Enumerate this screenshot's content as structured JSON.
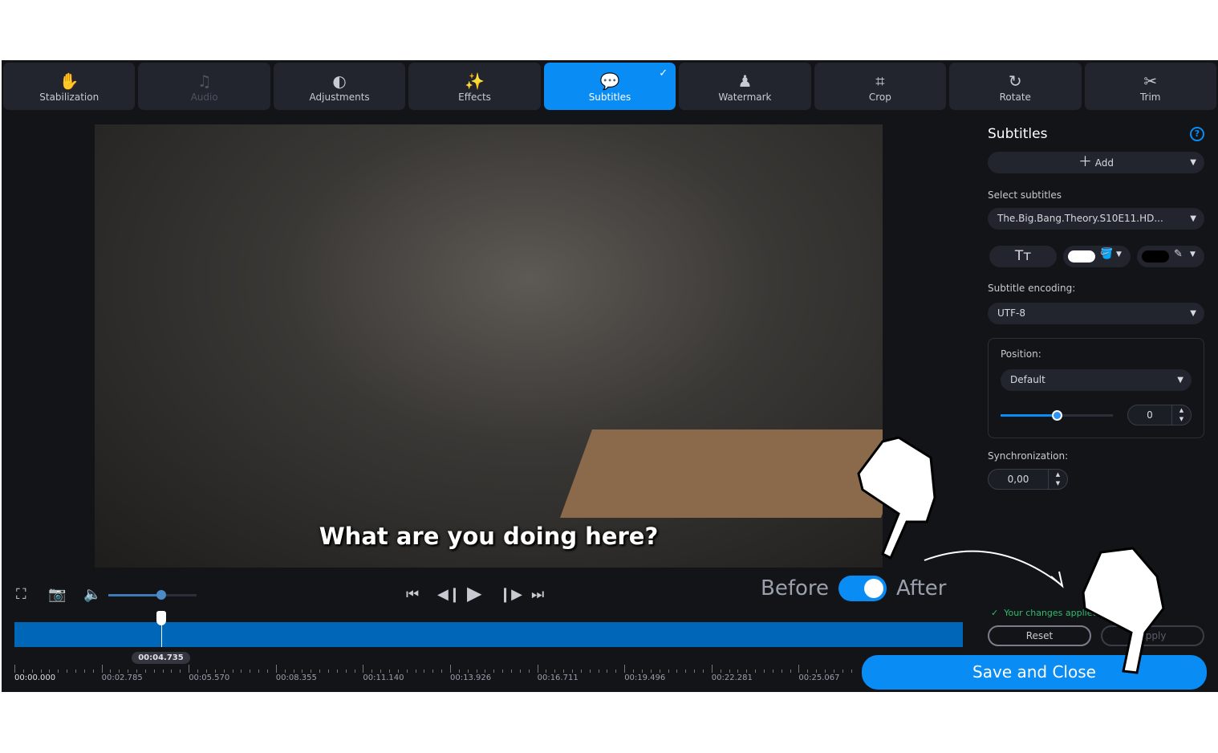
{
  "tabs": [
    {
      "key": "stabilization",
      "label": "Stabilization",
      "icon": "✋",
      "state": "normal"
    },
    {
      "key": "audio",
      "label": "Audio",
      "icon": "♫",
      "state": "disabled"
    },
    {
      "key": "adjustments",
      "label": "Adjustments",
      "icon": "◐",
      "state": "normal"
    },
    {
      "key": "effects",
      "label": "Effects",
      "icon": "✨",
      "state": "normal"
    },
    {
      "key": "subtitles",
      "label": "Subtitles",
      "icon": "💬",
      "state": "active"
    },
    {
      "key": "watermark",
      "label": "Watermark",
      "icon": "♟",
      "state": "normal"
    },
    {
      "key": "crop",
      "label": "Crop",
      "icon": "⌗",
      "state": "normal"
    },
    {
      "key": "rotate",
      "label": "Rotate",
      "icon": "↻",
      "state": "normal"
    },
    {
      "key": "trim",
      "label": "Trim",
      "icon": "✂",
      "state": "normal"
    }
  ],
  "active_check": "✓",
  "video": {
    "subtitle_text": "What are you doing here?",
    "volume": 0.6
  },
  "compare": {
    "before": "Before",
    "after": "After",
    "enabled": true
  },
  "timeline": {
    "current_time": "00:04.735",
    "current_fraction": 0.155,
    "labels": [
      "00:00.000",
      "00:02.785",
      "00:05.570",
      "00:08.355",
      "00:11.140",
      "00:13.926",
      "00:16.711",
      "00:19.496",
      "00:22.281",
      "00:25.067"
    ]
  },
  "panel": {
    "title": "Subtitles",
    "help": "?",
    "add_label": "Add",
    "select_label": "Select subtitles",
    "selected_file": "The.Big.Bang.Theory.S10E11.HD...",
    "text_color": "#ffffff",
    "outline_color": "#000000",
    "encoding_label": "Subtitle encoding:",
    "encoding": "UTF-8",
    "position_label": "Position:",
    "position": "Default",
    "position_offset": "0",
    "position_slider": 0.5,
    "sync_label": "Synchronization:",
    "sync_value": "0,00",
    "status": "Your changes applied",
    "reset": "Reset",
    "apply": "Apply",
    "save": "Save and Close"
  },
  "colors": {
    "accent": "#0a8cf5",
    "track": "#0067b8",
    "success": "#2dbd6e"
  }
}
